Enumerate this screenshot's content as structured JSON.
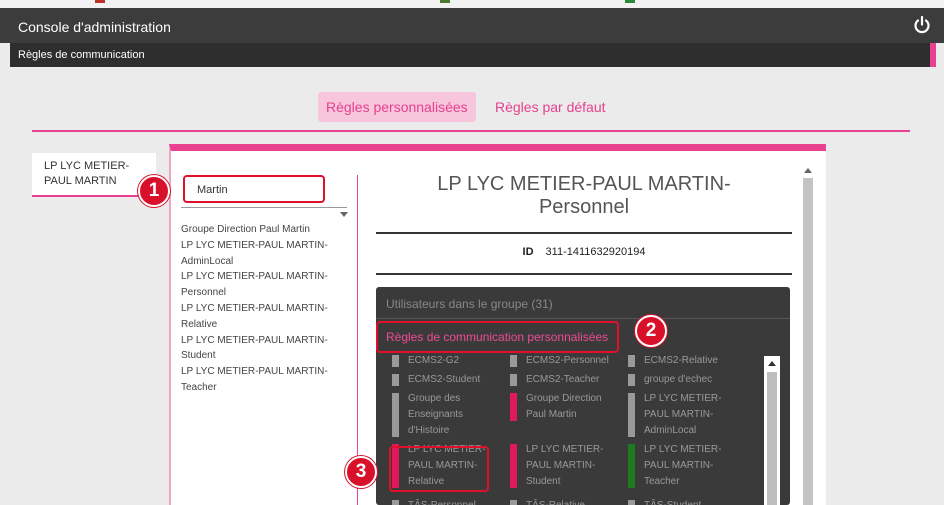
{
  "app": {
    "title": "Console d'administration"
  },
  "section": {
    "title": "Règles de communication"
  },
  "tabs": [
    {
      "label": "Règles personnalisées",
      "active": true
    },
    {
      "label": "Règles par défaut",
      "active": false
    }
  ],
  "school": {
    "name_line1": "LP LYC METIER-",
    "name_line2": "PAUL MARTIN"
  },
  "search": {
    "value": "Martin"
  },
  "groups": [
    "Groupe Direction Paul Martin",
    "LP LYC METIER-PAUL MARTIN-",
    "AdminLocal",
    "LP LYC METIER-PAUL MARTIN-",
    "Personnel",
    "LP LYC METIER-PAUL MARTIN-",
    "Relative",
    "LP LYC METIER-PAUL MARTIN-",
    "Student",
    "LP LYC METIER-PAUL MARTIN-",
    "Teacher"
  ],
  "detail": {
    "title_line1": "LP LYC METIER-PAUL MARTIN-",
    "title_line2": "Personnel",
    "id_label": "ID",
    "id_value": "311-1411632920194",
    "users_label": "Utilisateurs dans le groupe (31)",
    "rules_label": "Règles de communication personnalisées"
  },
  "rule_cells": [
    {
      "lines": [
        "ECMS2-G2"
      ],
      "color": "#9a9a9a"
    },
    {
      "lines": [
        "ECMS2-Personnel"
      ],
      "color": "#9a9a9a"
    },
    {
      "lines": [
        "ECMS2-Relative"
      ],
      "color": "#9a9a9a"
    },
    {
      "lines": [
        "ECMS2-Student"
      ],
      "color": "#9a9a9a"
    },
    {
      "lines": [
        "ECMS2-Teacher"
      ],
      "color": "#9a9a9a"
    },
    {
      "lines": [
        "groupe d'echec"
      ],
      "color": "#9a9a9a"
    },
    {
      "lines": [
        "Groupe des",
        "Enseignants",
        "d'Histoire"
      ],
      "color": "#9a9a9a"
    },
    {
      "lines": [
        "Groupe Direction",
        "Paul Martin"
      ],
      "color": "#e0195a"
    },
    {
      "lines": [
        "LP LYC METIER-",
        "PAUL MARTIN-",
        "AdminLocal"
      ],
      "color": "#9a9a9a"
    },
    {
      "lines": [
        "LP LYC METIER-",
        "PAUL MARTIN-",
        "Relative"
      ],
      "color": "#e0195a"
    },
    {
      "lines": [
        "LP LYC METIER-",
        "PAUL MARTIN-",
        "Student"
      ],
      "color": "#e0195a"
    },
    {
      "lines": [
        "LP LYC METIER-",
        "PAUL MARTIN-",
        "Teacher"
      ],
      "color": "#1f7a1f"
    },
    {
      "lines": [
        "TÂS-Personnel"
      ],
      "color": "#9a9a9a"
    },
    {
      "lines": [
        "TÂS-Relative"
      ],
      "color": "#9a9a9a"
    },
    {
      "lines": [
        "TÂS-Student"
      ],
      "color": "#9a9a9a"
    }
  ],
  "callouts": [
    "1",
    "2",
    "3"
  ],
  "colors": {
    "accent": "#e9418f",
    "callout": "#d8102a",
    "dark_panel": "#3a3a3a"
  },
  "icons": {
    "power": "power-icon"
  }
}
